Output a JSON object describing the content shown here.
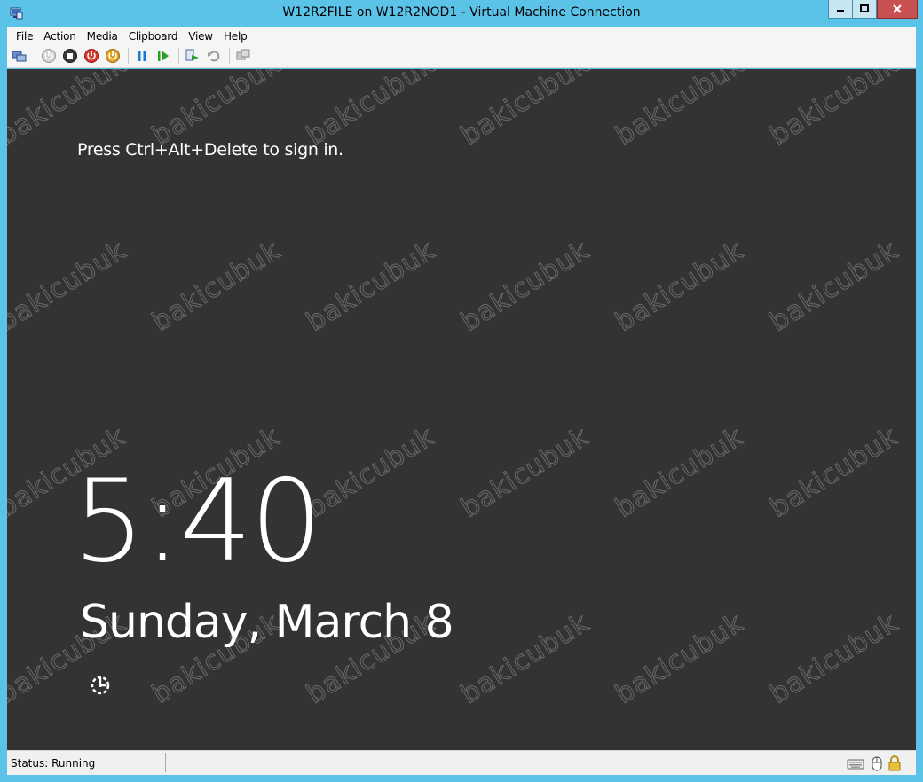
{
  "window": {
    "title": "W12R2FILE on W12R2NOD1 - Virtual Machine Connection",
    "accent": "#5cc3e8",
    "close_color": "#c75050"
  },
  "menu": {
    "items": [
      {
        "label": "File"
      },
      {
        "label": "Action"
      },
      {
        "label": "Media"
      },
      {
        "label": "Clipboard"
      },
      {
        "label": "View"
      },
      {
        "label": "Help"
      }
    ]
  },
  "toolbar": {
    "buttons": [
      {
        "name": "ctrl-alt-del-icon"
      },
      {
        "name": "start-icon"
      },
      {
        "name": "turn-off-icon"
      },
      {
        "name": "shut-down-icon"
      },
      {
        "name": "save-icon"
      },
      {
        "name": "pause-icon"
      },
      {
        "name": "resume-icon"
      },
      {
        "name": "checkpoint-icon"
      },
      {
        "name": "revert-icon"
      },
      {
        "name": "enhanced-session-icon"
      }
    ]
  },
  "vm_screen": {
    "background": "#333333",
    "signin_prompt": "Press Ctrl+Alt+Delete to sign in.",
    "time": "5:40",
    "date": "Sunday, March 8",
    "ease_of_access_icon": "ease-of-access-icon",
    "watermark": "bakicubuk"
  },
  "status": {
    "text": "Status: Running",
    "icons": [
      "keyboard-icon",
      "mouse-icon",
      "lock-icon"
    ]
  }
}
